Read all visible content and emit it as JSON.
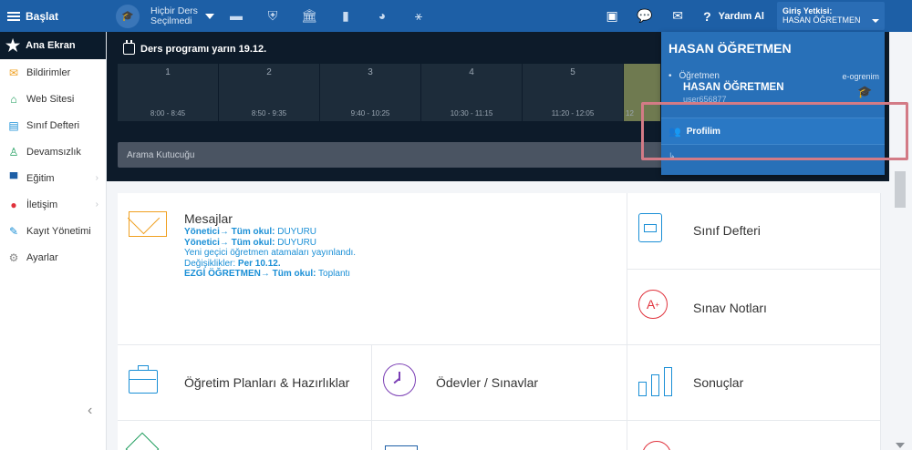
{
  "topbar": {
    "brand": "Başlat",
    "course_line1": "Hiçbir Ders",
    "course_line2": "Seçilmedi",
    "help": "Yardım Al",
    "auth_label": "Giriş Yetkisi:",
    "auth_user": "HASAN ÖĞRETMEN"
  },
  "sidebar": {
    "home": "Ana Ekran",
    "items": [
      {
        "label": "Bildirimler"
      },
      {
        "label": "Web Sitesi"
      },
      {
        "label": "Sınıf Defteri"
      },
      {
        "label": "Devamsızlık"
      },
      {
        "label": "Eğitim"
      },
      {
        "label": "İletişim"
      },
      {
        "label": "Kayıt Yönetimi"
      },
      {
        "label": "Ayarlar"
      }
    ]
  },
  "schedule": {
    "title": "Ders programı yarın 19.12.",
    "periods": [
      {
        "num": "1",
        "time": "8:00 - 8:45"
      },
      {
        "num": "2",
        "time": "8:50 - 9:35"
      },
      {
        "num": "3",
        "time": "9:40 - 10:25"
      },
      {
        "num": "4",
        "time": "10:30 - 11:15"
      },
      {
        "num": "5",
        "time": "11:20 - 12:05"
      },
      {
        "num": "",
        "time": "12"
      }
    ],
    "search_placeholder": "Arama Kutucuğu"
  },
  "cards": {
    "messages_title": "Mesajlar",
    "msg1_from": "Yönetici→ Tüm okul:",
    "msg1_text": " DUYURU",
    "msg2_from": "Yönetici→ Tüm okul:",
    "msg2_text": " DUYURU",
    "msg3_text": "Yeni geçici öğretmen atamaları yayınlandı.",
    "msg4_text": "Değişiklikler: ",
    "msg4_bold": "Per 10.12.",
    "msg5_from": "EZGİ ÖĞRETMEN→ Tüm okul:",
    "msg5_text": " Toplantı",
    "class_book": "Sınıf Defteri",
    "exam_grades": "Sınav Notları",
    "plans": "Öğretim Planları & Hazırlıklar",
    "homework": "Ödevler / Sınavlar",
    "results": "Sonuçlar"
  },
  "dropdown": {
    "name": "HASAN ÖĞRETMEN",
    "role": "Öğretmen",
    "fullname": "HASAN ÖĞRETMEN",
    "username": "user656877",
    "eogrenim": "e-ogrenim",
    "profile": "Profilim"
  },
  "colors": {
    "accent": "#1d5fa6",
    "orange": "#f0a020",
    "red": "#e0323c"
  }
}
